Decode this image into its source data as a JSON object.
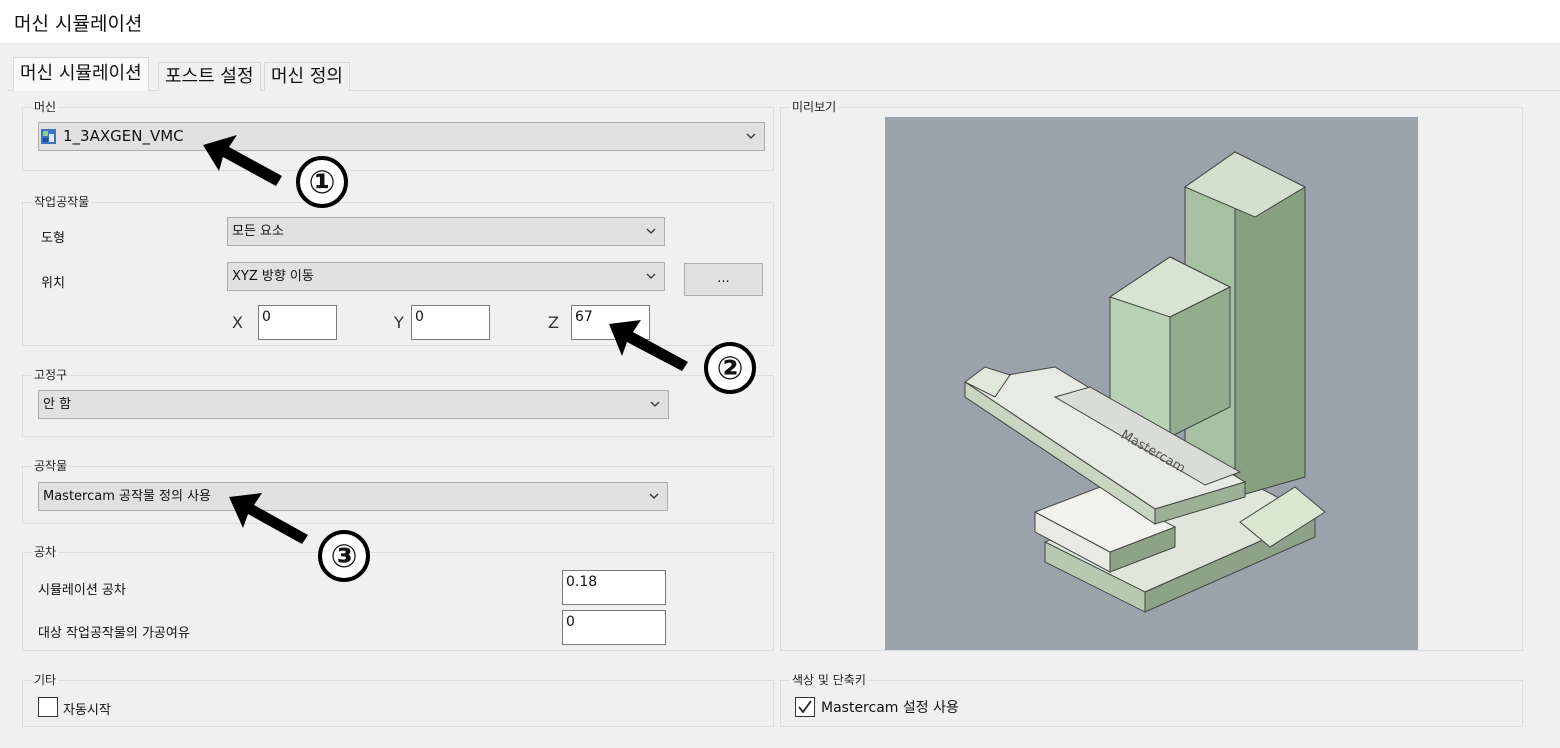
{
  "window": {
    "title": "머신 시뮬레이션"
  },
  "tabs": [
    {
      "label": "머신 시뮬레이션",
      "active": true
    },
    {
      "label": "포스트 설정",
      "active": false
    },
    {
      "label": "머신 정의",
      "active": false
    }
  ],
  "machine": {
    "group_label": "머신",
    "selected": "1_3AXGEN_VMC",
    "icon": "machine-icon"
  },
  "workpiece_group": {
    "group_label": "작업공작물",
    "geometry_label": "도형",
    "geometry_value": "모든 요소",
    "position_label": "위치",
    "position_value": "XYZ 방향 이동",
    "browse_label": "...",
    "x_label": "X",
    "x_value": "0",
    "y_label": "Y",
    "y_value": "0",
    "z_label": "Z",
    "z_value": "67"
  },
  "fixture": {
    "group_label": "고정구",
    "selected": "안 함"
  },
  "stock": {
    "group_label": "공작물",
    "selected": "Mastercam 공작물 정의 사용"
  },
  "tolerance": {
    "group_label": "공차",
    "sim_tol_label": "시뮬레이션 공차",
    "sim_tol_value": "0.18",
    "allowance_label": "대상 작업공작물의 가공여유",
    "allowance_value": "0"
  },
  "preview": {
    "group_label": "미리보기",
    "logo_text": "Mastercam"
  },
  "misc": {
    "group_label": "기타",
    "autostart_label": "자동시작",
    "autostart_checked": false
  },
  "colors_keys": {
    "group_label": "색상 및 단축키",
    "use_settings_label": "Mastercam 설정 사용",
    "use_settings_checked": true
  },
  "callouts": [
    "①",
    "②",
    "③"
  ],
  "colors": {
    "preview_bg": "#9aa3ac",
    "machine_green": "#b9d1b4",
    "window_bg": "#f0f0f0"
  }
}
